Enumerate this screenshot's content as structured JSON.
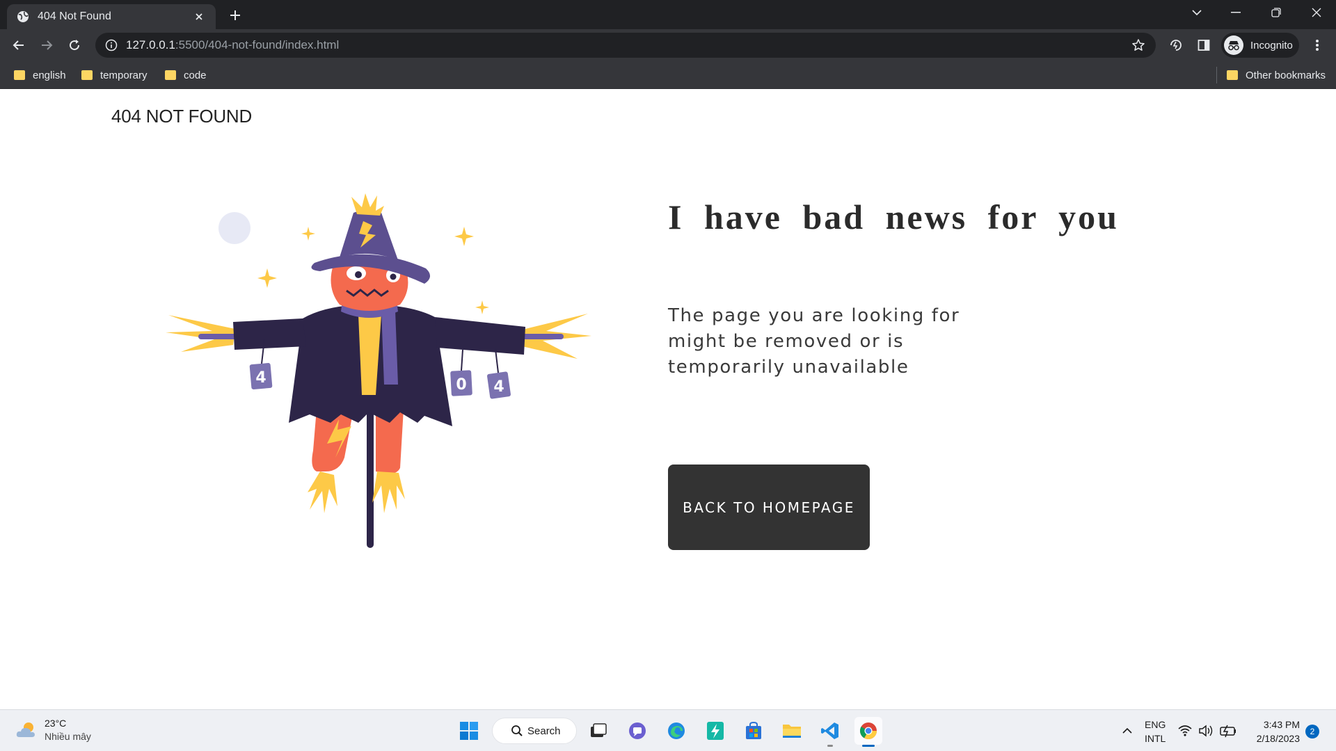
{
  "browser": {
    "tab": {
      "title": "404 Not Found"
    },
    "address": {
      "host": "127.0.0.1",
      "path": ":5500/404-not-found/index.html"
    },
    "profile": {
      "label": "Incognito"
    },
    "bookmarks": [
      {
        "label": "english"
      },
      {
        "label": "temporary"
      },
      {
        "label": "code"
      }
    ],
    "other_bookmarks": "Other bookmarks"
  },
  "page": {
    "brand": "404 NOT FOUND",
    "headline": "I have bad news for you",
    "message": "The page you are looking for might be removed or is temporarily unavailable",
    "cta_label": "BACK TO HOMEPAGE",
    "illustration": {
      "subject": "scarecrow",
      "tags": [
        "4",
        "0",
        "4"
      ]
    }
  },
  "taskbar": {
    "weather": {
      "temp": "23°C",
      "condition": "Nhiều mây"
    },
    "search_label": "Search",
    "language": {
      "line1": "ENG",
      "line2": "INTL"
    },
    "clock": {
      "time": "3:43 PM",
      "date": "2/18/2023"
    },
    "notifications": "2"
  },
  "colors": {
    "chrome_dark": "#202124",
    "chrome_toolbar": "#35363a",
    "cta_bg": "#333333",
    "hat": "#5c4f8f",
    "coat": "#2d2548",
    "head": "#f46a4e",
    "straw": "#fdc947"
  }
}
